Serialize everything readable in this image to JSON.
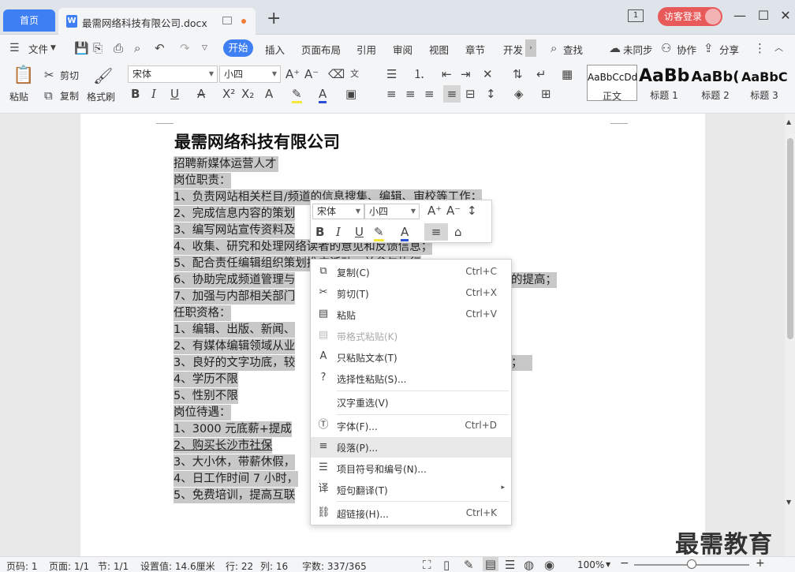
{
  "tabs": {
    "home": "首页",
    "doc": "最需网络科技有限公司.docx",
    "new": "+"
  },
  "titlebar": {
    "badge": "1",
    "visitor": "访客登录",
    "min": "—",
    "max": "☐",
    "close": "✕"
  },
  "menu": {
    "file": "文件",
    "items": [
      "开始",
      "插入",
      "页面布局",
      "引用",
      "审阅",
      "视图",
      "章节",
      "开发"
    ],
    "search": "查找",
    "sync": "未同步",
    "collab": "协作",
    "share": "分享"
  },
  "ribbon": {
    "paste": "粘贴",
    "cut": "剪切",
    "copy": "复制",
    "format_painter": "格式刷",
    "font": "宋体",
    "size": "小四",
    "styles": [
      {
        "preview": "AaBbCcDd",
        "name": "正文"
      },
      {
        "preview": "AaBb",
        "name": "标题 1"
      },
      {
        "preview": "AaBb(",
        "name": "标题 2"
      },
      {
        "preview": "AaBbC",
        "name": "标题 3"
      }
    ]
  },
  "document": {
    "title": "最需网络科技有限公司",
    "lines": [
      "招聘新媒体运营人才",
      "岗位职责：",
      "1、负责网站相关栏目/频道的信息搜集、编辑、审校等工作；",
      "2、完成信息内容的策划",
      "3、编写网站宣传资料及",
      "4、收集、研究和处理网络读者的意见和反馈信息；",
      "5、配合责任编辑组织策划推广活动，并参与执行",
      "6、协助完成频道管理与",
      "7、加强与内部相关部门",
      "任职资格：",
      "1、编辑、出版、新闻、",
      "2、有媒体编辑领域从业",
      "3、良好的文字功底，较",
      "4、学历不限",
      "5、性别不限",
      "岗位待遇：",
      "1、3000 元底薪+提成",
      "2、购买长沙市社保",
      "3、大小休，带薪休假，",
      "4、日工作时间 7 小时，",
      "5、免费培训，提高互联"
    ],
    "tail6": "的提高；",
    "tail12": "；"
  },
  "minibar": {
    "font": "宋体",
    "size": "小四"
  },
  "context_menu": [
    {
      "icon": "copy-icon",
      "glyph": "⧉",
      "label": "复制(C)",
      "shortcut": "Ctrl+C",
      "disabled": false
    },
    {
      "icon": "scissors-icon",
      "glyph": "✂",
      "label": "剪切(T)",
      "shortcut": "Ctrl+X",
      "disabled": false
    },
    {
      "icon": "paste-icon",
      "glyph": "📋",
      "label": "粘贴",
      "shortcut": "Ctrl+V",
      "disabled": false
    },
    {
      "icon": "paste-format-icon",
      "glyph": "▤",
      "label": "带格式粘贴(K)",
      "shortcut": "",
      "disabled": true
    },
    {
      "icon": "paste-text-icon",
      "glyph": "A",
      "label": "只粘贴文本(T)",
      "shortcut": "",
      "disabled": false
    },
    {
      "icon": "paste-special-icon",
      "glyph": "?",
      "label": "选择性粘贴(S)...",
      "shortcut": "",
      "disabled": false
    },
    {
      "icon": "",
      "glyph": "",
      "label": "汉字重选(V)",
      "shortcut": "",
      "disabled": false
    },
    {
      "icon": "font-icon",
      "glyph": "Ⓣ",
      "label": "字体(F)...",
      "shortcut": "Ctrl+D",
      "disabled": false
    },
    {
      "icon": "paragraph-icon",
      "glyph": "≡",
      "label": "段落(P)...",
      "shortcut": "",
      "disabled": false
    },
    {
      "icon": "list-icon",
      "glyph": "☰",
      "label": "项目符号和编号(N)...",
      "shortcut": "",
      "disabled": false
    },
    {
      "icon": "translate-icon",
      "glyph": "译",
      "label": "短句翻译(T)",
      "shortcut": "",
      "disabled": false
    },
    {
      "icon": "link-icon",
      "glyph": "⛓",
      "label": "超链接(H)...",
      "shortcut": "Ctrl+K",
      "disabled": false
    }
  ],
  "status": {
    "page_no": "页码: 1",
    "pages": "页面: 1/1",
    "section": "节: 1/1",
    "setting": "设置值: 14.6厘米",
    "row": "行: 22",
    "col": "列: 16",
    "words": "字数: 337/365",
    "zoom": "100%",
    "minus": "−",
    "plus": "+"
  },
  "watermark": "最需教育"
}
